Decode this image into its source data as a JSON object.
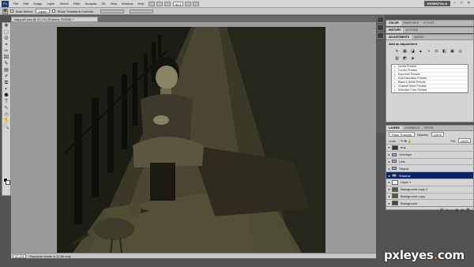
{
  "menubar": {
    "logo": "Ps",
    "items": [
      "File",
      "Edit",
      "Image",
      "Layer",
      "Select",
      "Filter",
      "Analysis",
      "3D",
      "View",
      "Window",
      "Help"
    ],
    "zoom": "41.1",
    "workspace": "ESSENTIALS",
    "window_controls": [
      "–",
      "□",
      "✕"
    ]
  },
  "options": {
    "auto_select_label": "Auto-Select:",
    "auto_select_value": "Layer",
    "transform_label": "Show Transform Controls"
  },
  "document": {
    "tab_title": "stappal0.psd @ 41.1% (Shadow, RGB/8) *"
  },
  "toolbox": {
    "tools": [
      "✥",
      "⬚",
      "ʘ",
      "⌖",
      "✂",
      "⌧",
      "✎",
      "▤",
      "✐",
      "⧉",
      "◐",
      "⬢",
      "T",
      "↖",
      "◇",
      "✋",
      "🔍"
    ]
  },
  "status": {
    "zoom": "41.1%",
    "doc": "Exposure works in 32-bit only"
  },
  "panels": {
    "top_tabs": [
      "COLOR",
      "SWATCHES",
      "STYLES"
    ],
    "mid_tabs": [
      "HISTORY",
      "ACTIONS"
    ],
    "adj_tabs": [
      "ADJUSTMENTS",
      "MASKS"
    ],
    "adj_title": "Add an adjustment",
    "adj_icons": [
      "☀",
      "▦",
      "◪",
      "▲",
      "◑",
      "⚖",
      "◧",
      "▣",
      "◎",
      "▥",
      "◩",
      "◈"
    ],
    "presets": [
      "Levels Presets",
      "Curves Presets",
      "Exposure Presets",
      "Hue/Saturation Presets",
      "Black & White Presets",
      "Channel Mixer Presets",
      "Selective Color Presets"
    ],
    "layer_tabs": [
      "LAYERS",
      "CHANNELS",
      "PATHS"
    ],
    "blend_mode": "Pass Through",
    "opacity_label": "Opacity:",
    "opacity": "100%",
    "lock_label": "Lock:",
    "fill_label": "Fill:",
    "fill": "100%",
    "layers": [
      {
        "name": "boy",
        "type": "image",
        "visible": true,
        "selected": false
      },
      {
        "name": "Overlays",
        "type": "folder",
        "visible": true,
        "selected": false
      },
      {
        "name": "Lets",
        "type": "folder",
        "visible": true,
        "selected": false
      },
      {
        "name": "Steps4",
        "type": "folder",
        "visible": true,
        "selected": false
      },
      {
        "name": "Shadow",
        "type": "folder",
        "visible": true,
        "selected": true
      },
      {
        "name": "Layer 1",
        "type": "plain",
        "visible": true,
        "selected": false
      },
      {
        "name": "Background copy 2",
        "type": "image",
        "visible": true,
        "selected": false
      },
      {
        "name": "Background copy",
        "type": "image",
        "visible": true,
        "selected": false
      },
      {
        "name": "Background",
        "type": "image",
        "visible": true,
        "selected": false
      }
    ],
    "layer_footer": [
      "⛓",
      "fx",
      "◐",
      "▣",
      "▤",
      "🗑"
    ]
  },
  "watermark": {
    "text1": "pxleyes",
    "dot": ".",
    "text2": "com"
  }
}
